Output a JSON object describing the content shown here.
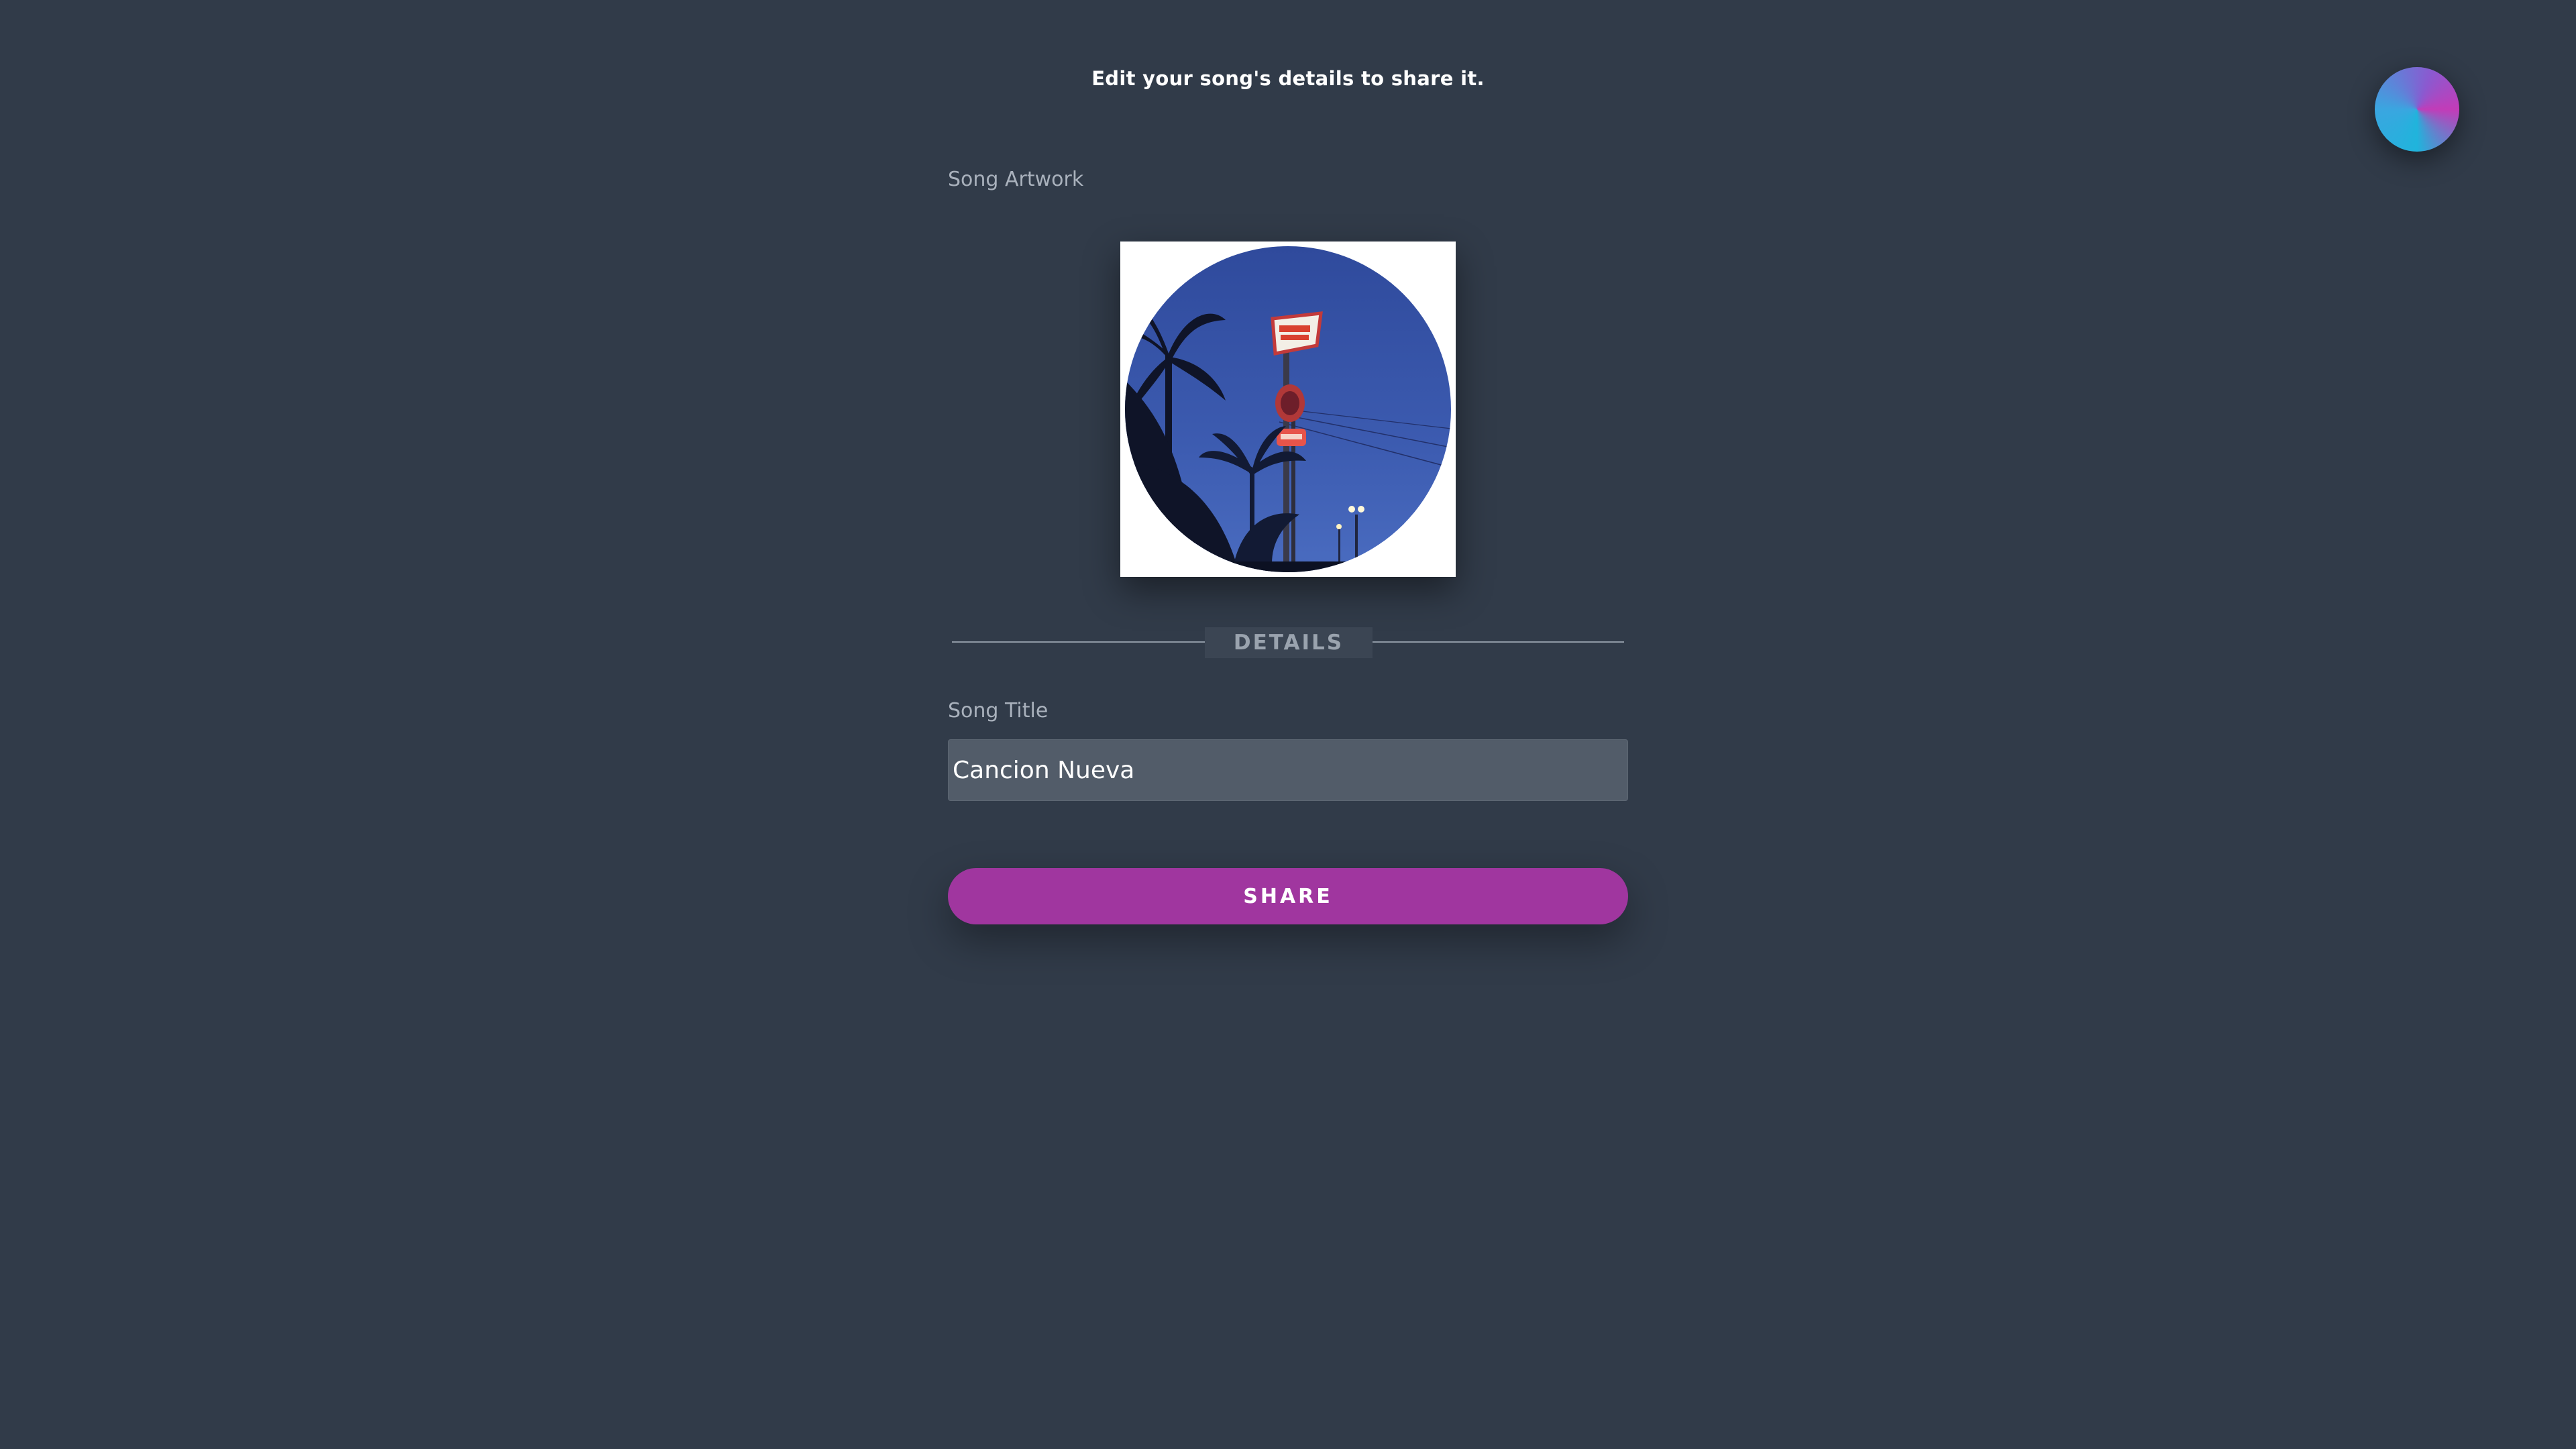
{
  "header": {
    "title": "Edit your song's details to share it."
  },
  "user": {
    "avatar_icon": "avatar-gradient-icon",
    "colors": [
      "#c23cb8",
      "#20b4dc"
    ]
  },
  "form": {
    "artwork_label": "Song Artwork",
    "artwork_image": "night-sky-palm-trees-neon-sign",
    "section_label": "DETAILS",
    "title_label": "Song Title",
    "title_value": "Cancion Nueva",
    "share_label": "SHARE"
  },
  "colors": {
    "background": "#313b49",
    "accent": "#a0369f",
    "input_bg": "#525c69"
  }
}
